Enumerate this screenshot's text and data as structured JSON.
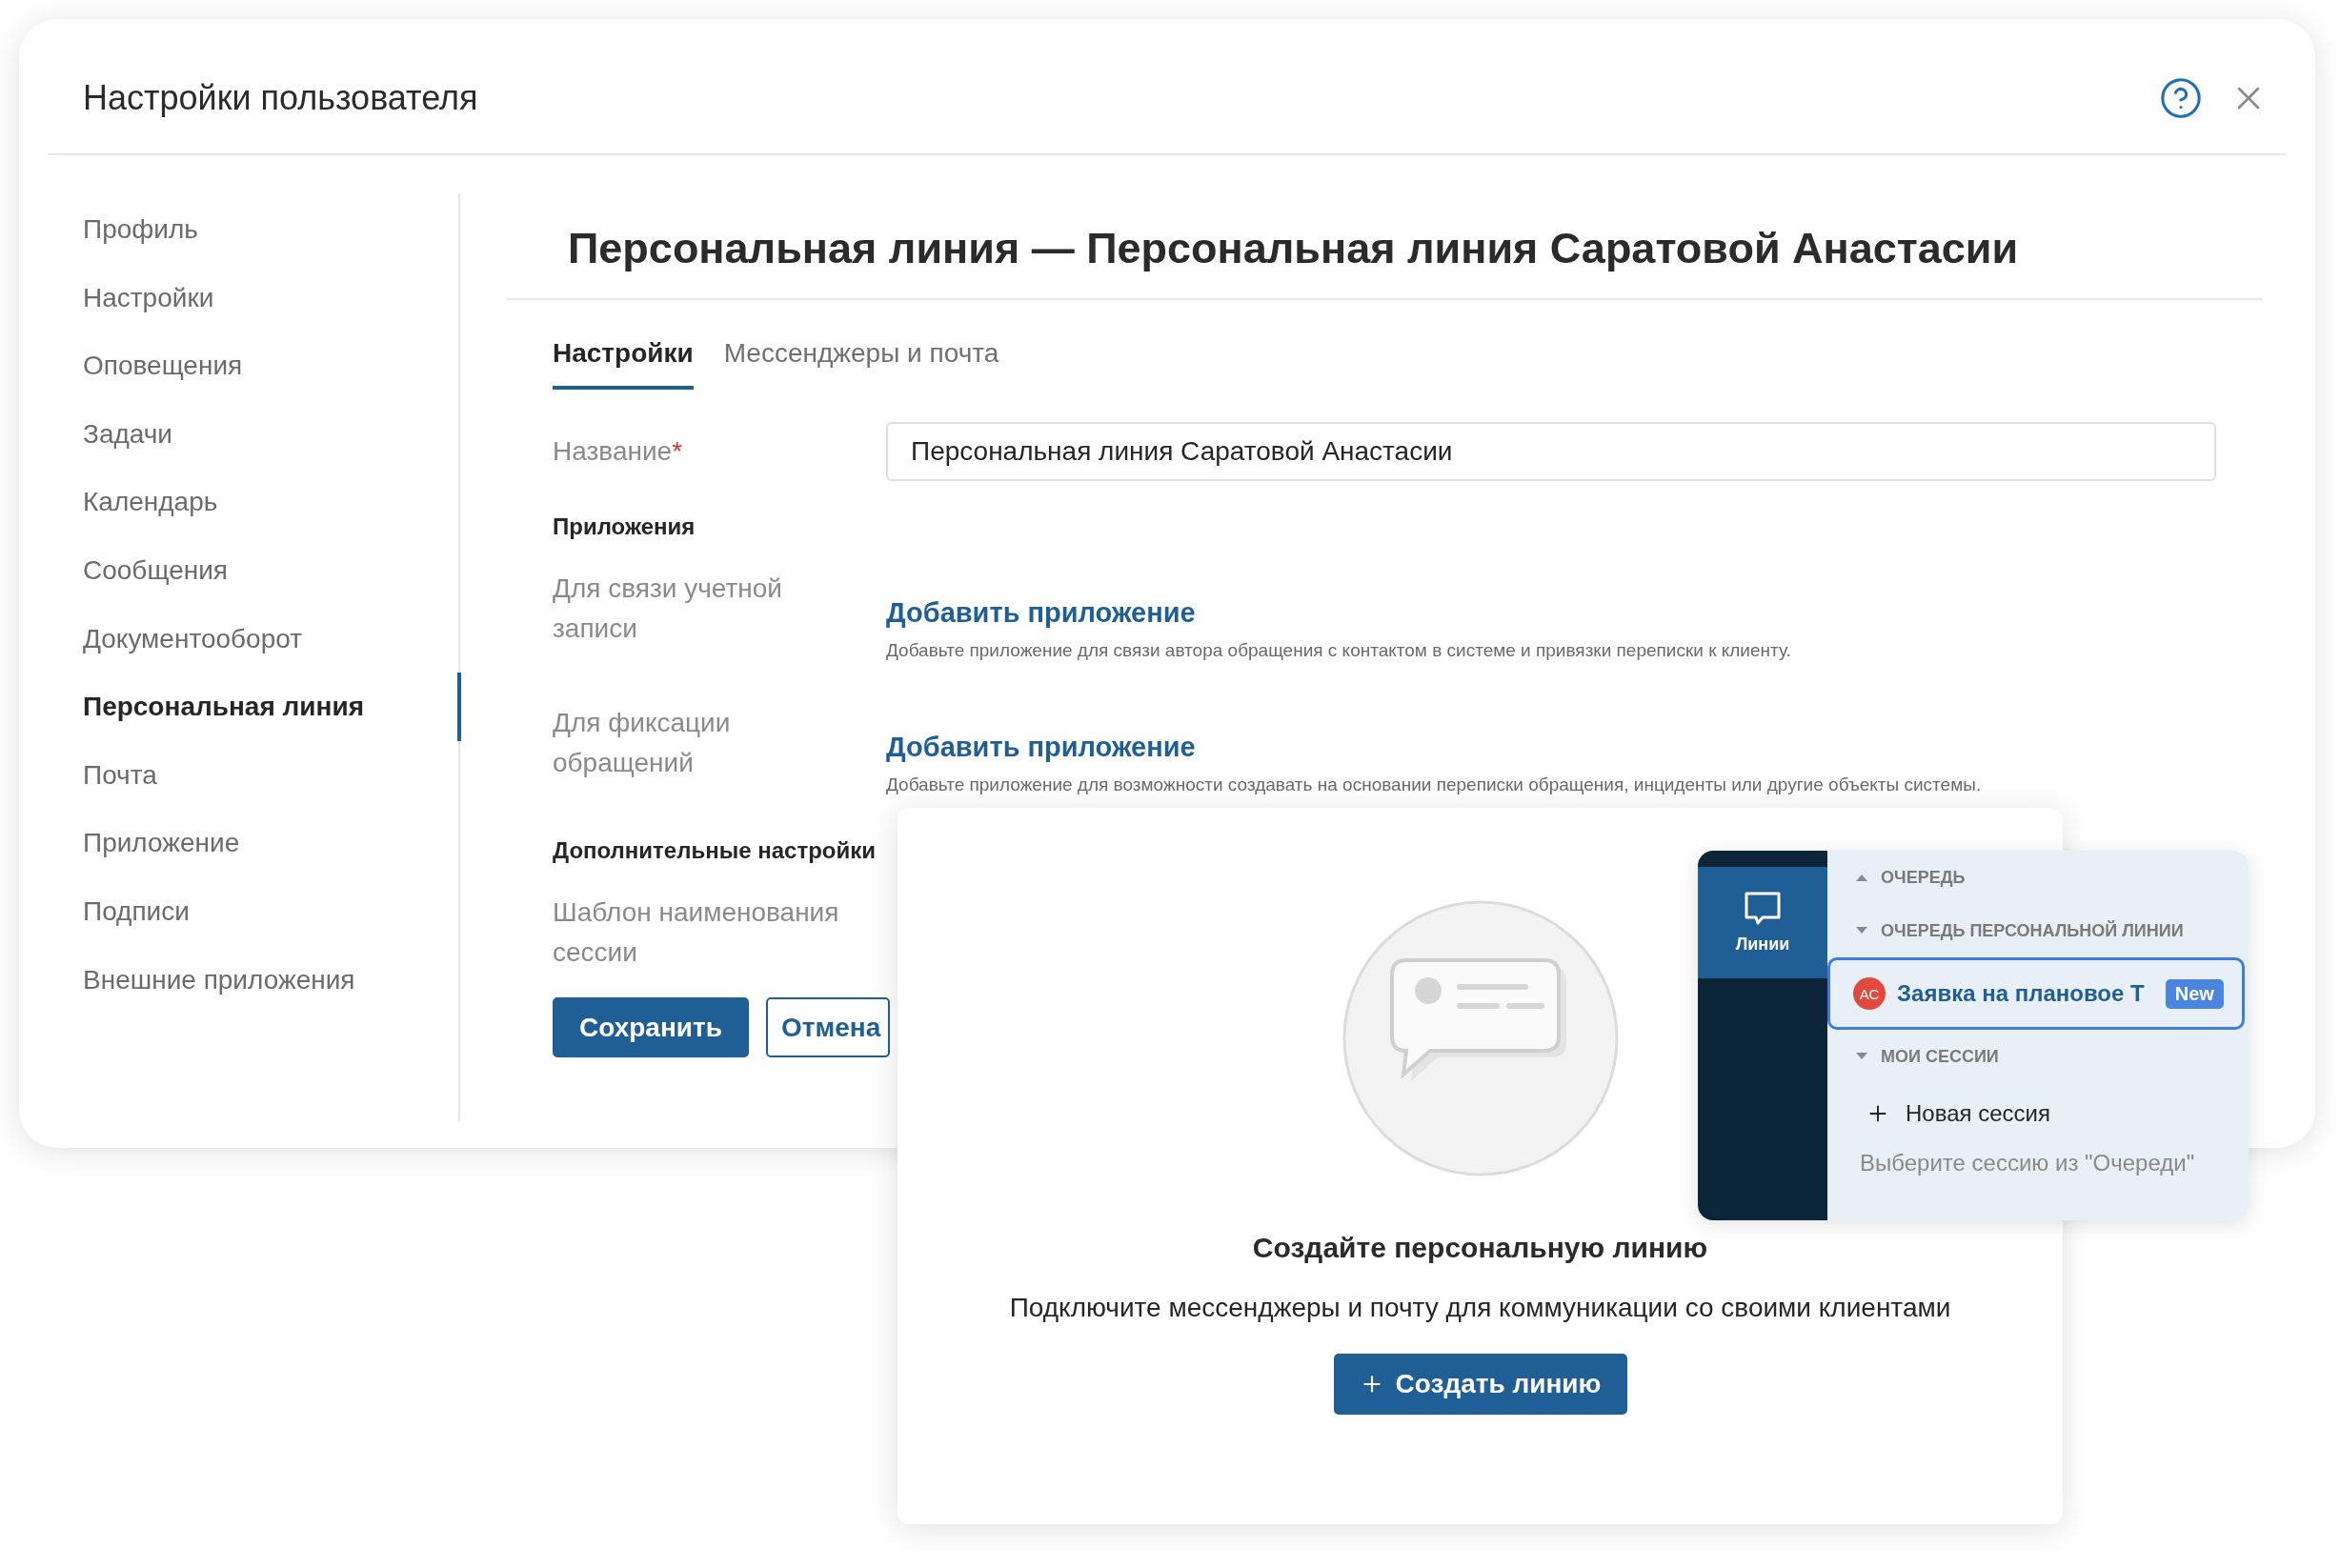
{
  "dialog": {
    "title": "Настройки пользователя",
    "sidebar": {
      "items": [
        {
          "label": "Профиль",
          "selected": false
        },
        {
          "label": "Настройки",
          "selected": false
        },
        {
          "label": "Оповещения",
          "selected": false
        },
        {
          "label": "Задачи",
          "selected": false
        },
        {
          "label": "Календарь",
          "selected": false
        },
        {
          "label": "Сообщения",
          "selected": false
        },
        {
          "label": "Документооборот",
          "selected": false
        },
        {
          "label": "Персональная линия",
          "selected": true
        },
        {
          "label": "Почта",
          "selected": false
        },
        {
          "label": "Приложение",
          "selected": false
        },
        {
          "label": "Подписи",
          "selected": false
        },
        {
          "label": "Внешние приложения",
          "selected": false
        }
      ]
    },
    "content": {
      "heading": "Персональная линия — Персональная линия Саратовой Анастасии",
      "tabs": [
        {
          "label": "Настройки",
          "selected": true
        },
        {
          "label": "Мессенджеры и почта",
          "selected": false
        }
      ],
      "rows": [
        {
          "kind": "input",
          "label": "Название",
          "required_mark": "*",
          "value": "Персональная линия Саратовой Анастасии"
        },
        {
          "kind": "section",
          "label": "Приложения"
        },
        {
          "kind": "app",
          "label": "Для связи учетной записи",
          "link": "Добавить приложение",
          "description": "Добавьте приложение для связи автора обращения с контактом в системе и привязки переписки к клиенту."
        },
        {
          "kind": "app",
          "label": "Для фиксации обращений",
          "link": "Добавить приложение",
          "description": "Добавьте приложение для возможности создавать на основании переписки обращения, инциденты или другие объекты системы."
        },
        {
          "kind": "section",
          "label": "Дополнительные настройки"
        },
        {
          "kind": "label",
          "label": "Шаблон наименования сессии"
        }
      ],
      "buttons": [
        {
          "label": "Сохранить",
          "kind": "primary"
        },
        {
          "label": "Отмена",
          "kind": "secondary"
        }
      ]
    }
  },
  "create_card": {
    "title": "Создайте персональную линию",
    "subtitle": "Подключите мессенджеры и почту для коммуникации со своими клиентами",
    "button": "Создать линию"
  },
  "lines_panel": {
    "nav": {
      "label": "Линии",
      "selected": true
    },
    "groups": [
      {
        "title": "ОЧЕРЕДЬ",
        "expanded": false
      },
      {
        "title": "ОЧЕРЕДЬ ПЕРСОНАЛЬНОЙ ЛИНИИ",
        "expanded": true,
        "items": [
          {
            "initials": "АС",
            "title": "Заявка на плановое Т",
            "badge": "New",
            "selected": true
          }
        ]
      },
      {
        "title": "МОИ СЕССИИ",
        "expanded": true
      }
    ],
    "new_session": "Новая сессия",
    "hint": "Выберите сессию из \"Очереди\""
  }
}
